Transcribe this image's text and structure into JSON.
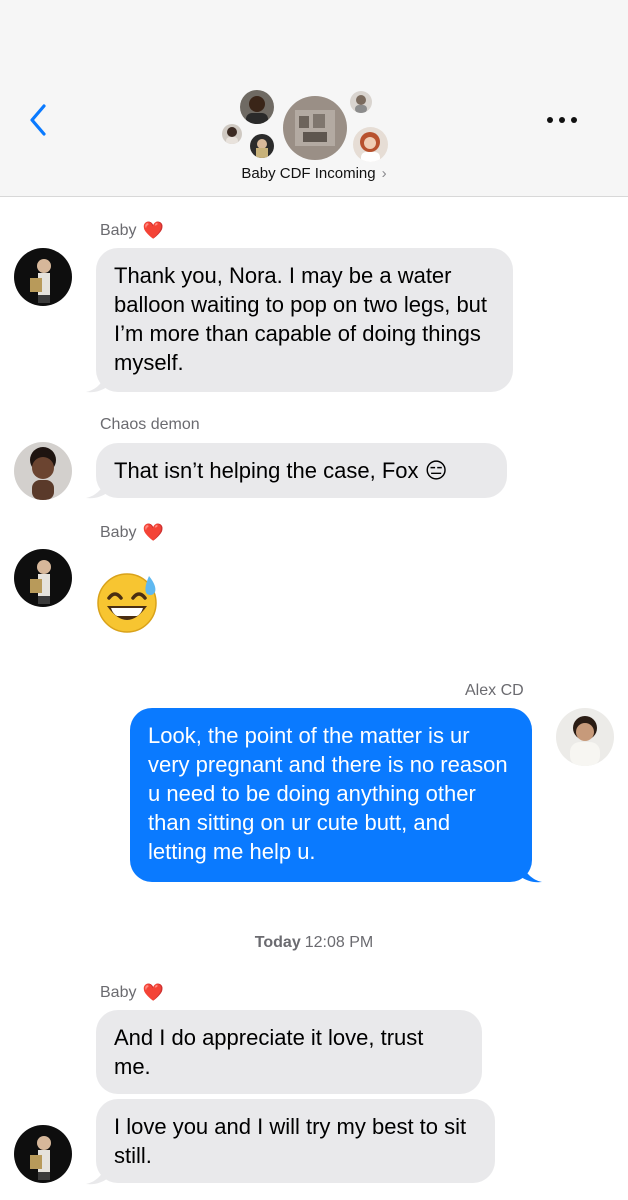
{
  "header": {
    "group_name": "Baby CDF Incoming",
    "chevron": "›"
  },
  "colors": {
    "accent": "#0a7aff",
    "incoming_bubble": "#e9e9eb",
    "header_bg": "#f6f6f6"
  },
  "icons": {
    "back": "chevron-left-icon",
    "more": "ellipsis-icon",
    "heart": "red-heart-emoji"
  },
  "messages": [
    {
      "sender": "Baby",
      "heart": "❤️",
      "text": "Thank you, Nora. I may be a water balloon waiting to pop on two legs, but I’m more than capable of doing things myself."
    },
    {
      "sender": "Chaos demon",
      "text": "That isn’t helping the case, Fox 😑"
    },
    {
      "sender": "Baby",
      "heart": "❤️",
      "text": "😅"
    },
    {
      "sender": "Alex CD",
      "text": "Look, the point of the matter is ur very pregnant and there is no reason u need to be doing anything other than sitting on ur cute butt, and letting me help u."
    },
    {
      "sender": "Baby",
      "heart": "❤️",
      "text": "And I do appreciate it love, trust me."
    },
    {
      "text": "I love you and I will try my best to sit still."
    }
  ],
  "timestamp": {
    "day": "Today",
    "time": "12:08 PM"
  }
}
